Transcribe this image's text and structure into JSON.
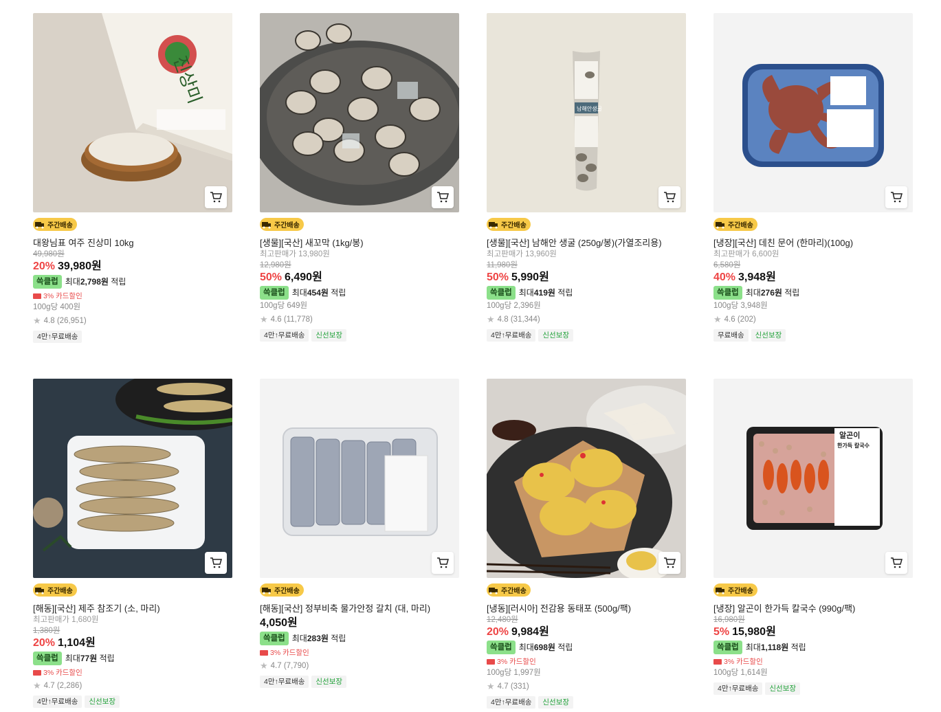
{
  "delivery_badge": "주간배송",
  "points_badge": "쓱클럽",
  "card_discount": "3% 카드할인",
  "products": [
    {
      "name": "대왕님표 여주 진상미 10kg",
      "ref_price": "",
      "orig_price": "49,980원",
      "discount": "20%",
      "price": "39,980원",
      "points_prefix": "최대",
      "points": "2,798원",
      "points_suffix": "적립",
      "card_discount": true,
      "unit_price": "100g당 400원",
      "rating": "4.8 (26,951)",
      "tags": [
        "4만↑무료배송"
      ]
    },
    {
      "name": "[생물][국산] 새꼬막 (1kg/봉)",
      "ref_price": "최고판매가 13,980원",
      "orig_price": "12,980원",
      "discount": "50%",
      "price": "6,490원",
      "points_prefix": "최대",
      "points": "454원",
      "points_suffix": "적립",
      "card_discount": false,
      "unit_price": "100g당 649원",
      "rating": "4.6 (11,778)",
      "tags": [
        "4만↑무료배송",
        "신선보장"
      ]
    },
    {
      "name": "[생물][국산] 남해안 생굴 (250g/봉)(가열조리용)",
      "ref_price": "최고판매가 13,960원",
      "orig_price": "11,980원",
      "discount": "50%",
      "price": "5,990원",
      "points_prefix": "최대",
      "points": "419원",
      "points_suffix": "적립",
      "card_discount": false,
      "unit_price": "100g당 2,396원",
      "rating": "4.8 (31,344)",
      "tags": [
        "4만↑무료배송",
        "신선보장"
      ]
    },
    {
      "name": "[냉장][국산] 데친 문어 (한마리)(100g)",
      "ref_price": "최고판매가 6,600원",
      "orig_price": "6,580원",
      "discount": "40%",
      "price": "3,948원",
      "points_prefix": "최대",
      "points": "276원",
      "points_suffix": "적립",
      "card_discount": false,
      "unit_price": "100g당 3,948원",
      "rating": "4.6 (202)",
      "tags": [
        "무료배송",
        "신선보장"
      ]
    },
    {
      "name": "[해동][국산] 제주 참조기 (소, 마리)",
      "ref_price": "최고판매가 1,680원",
      "orig_price": "1,380원",
      "discount": "20%",
      "price": "1,104원",
      "points_prefix": "최대",
      "points": "77원",
      "points_suffix": "적립",
      "card_discount": true,
      "unit_price": "",
      "rating": "4.7 (2,286)",
      "tags": [
        "4만↑무료배송",
        "신선보장"
      ]
    },
    {
      "name": "[해동][국산] 정부비축 물가안정 갈치 (대, 마리)",
      "ref_price": "",
      "orig_price": "",
      "discount": "",
      "price": "4,050원",
      "points_prefix": "최대",
      "points": "283원",
      "points_suffix": "적립",
      "card_discount": true,
      "unit_price": "",
      "rating": "4.7 (7,790)",
      "tags": [
        "4만↑무료배송",
        "신선보장"
      ]
    },
    {
      "name": "[냉동][러시아] 전감용 동태포 (500g/팩)",
      "ref_price": "",
      "orig_price": "12,480원",
      "discount": "20%",
      "price": "9,984원",
      "points_prefix": "최대",
      "points": "698원",
      "points_suffix": "적립",
      "card_discount": true,
      "unit_price": "100g당 1,997원",
      "rating": "4.7 (331)",
      "tags": [
        "4만↑무료배송",
        "신선보장"
      ]
    },
    {
      "name": "[냉장] 알곤이 한가득 칼국수 (990g/팩)",
      "ref_price": "",
      "orig_price": "16,980원",
      "discount": "5%",
      "price": "15,980원",
      "points_prefix": "최대",
      "points": "1,118원",
      "points_suffix": "적립",
      "card_discount": true,
      "unit_price": "100g당 1,614원",
      "rating": "",
      "tags": [
        "4만↑무료배송",
        "신선보장"
      ]
    }
  ],
  "images": {
    "rice_bag_text": "진상미",
    "oyster_label": "남해안생굴",
    "noodle_label_1": "알곤이",
    "noodle_label_2": "한가득 칼국수"
  }
}
